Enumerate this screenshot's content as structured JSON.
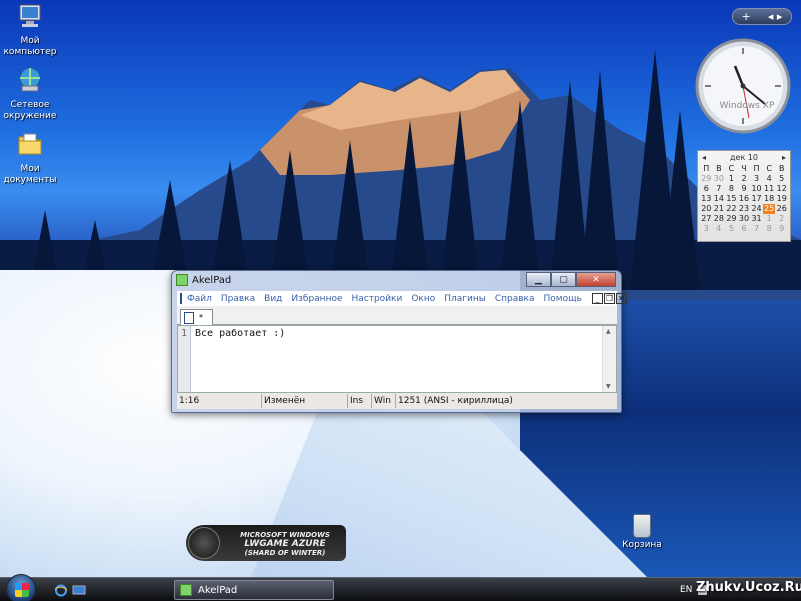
{
  "desktop": {
    "icons": [
      {
        "label": "Мой компьютер",
        "icon": "my-computer-icon"
      },
      {
        "label": "Сетевое окружение",
        "icon": "network-icon"
      },
      {
        "label": "Мои документы",
        "icon": "documents-folder-icon"
      }
    ],
    "recycle_bin": {
      "label": "Корзина",
      "icon": "recycle-bin-icon"
    },
    "logo": {
      "line1": "MICROSOFT WINDOWS",
      "line2": "LWGAME AZURE",
      "line3": "(SHARD OF WINTER)"
    }
  },
  "gadgets": {
    "toolbar": {
      "add_label": "+",
      "nav_label": "◂ ▸"
    },
    "clock": {
      "brand": "Windows XP"
    },
    "calendar": {
      "month": "дек 10",
      "weekdays": [
        "П",
        "В",
        "С",
        "Ч",
        "П",
        "С",
        "В"
      ],
      "days": [
        [
          "29",
          "30",
          "1",
          "2",
          "3",
          "4",
          "5"
        ],
        [
          "6",
          "7",
          "8",
          "9",
          "10",
          "11",
          "12"
        ],
        [
          "13",
          "14",
          "15",
          "16",
          "17",
          "18",
          "19"
        ],
        [
          "20",
          "21",
          "22",
          "23",
          "24",
          "25",
          "26"
        ],
        [
          "27",
          "28",
          "29",
          "30",
          "31",
          "1",
          "2"
        ],
        [
          "3",
          "4",
          "5",
          "6",
          "7",
          "8",
          "9"
        ]
      ],
      "today": "25"
    }
  },
  "window": {
    "title": "AkelPad",
    "controls": {
      "minimize": "▁",
      "maximize": "▢",
      "close": "✕"
    },
    "menu": [
      "Файл",
      "Правка",
      "Вид",
      "Избранное",
      "Настройки",
      "Окно",
      "Плагины",
      "Справка",
      "Помощь"
    ],
    "mdi_controls": {
      "minimize": "_",
      "restore": "❐",
      "close": "✕"
    },
    "tab": {
      "label": "*"
    },
    "editor": {
      "line_number": "1",
      "content": "Все работает :)"
    },
    "status": {
      "position": "1:16",
      "modified": "Изменён",
      "insert_mode": "Ins",
      "newline": "Win",
      "encoding": "1251  (ANSI - кириллица)"
    }
  },
  "taskbar": {
    "task_label": "AkelPad",
    "language": "EN",
    "watermark": "Zhukv.Ucoz.Ru"
  }
}
